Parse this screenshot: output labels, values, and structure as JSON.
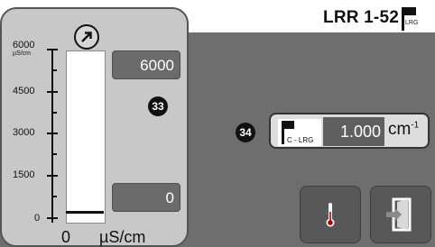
{
  "header": {
    "model": "LRR 1-52",
    "flag_text": "LRG"
  },
  "level_panel": {
    "scale": [
      "6000",
      "4500",
      "3000",
      "1500",
      "0"
    ],
    "scale_unit": "µS/cm",
    "max_value": "6000",
    "min_value": "0",
    "bottom_value": "0",
    "bottom_unit": "µS/cm",
    "badge": "33",
    "fill_fraction": 0.0
  },
  "cell_constant": {
    "badge": "34",
    "flag_text": "C - LRG",
    "value": "1.000",
    "unit": "cm",
    "unit_exp": "-1"
  },
  "icons": {
    "up_button": "arrow-up-right-circle-icon",
    "thermometer": "thermometer-icon",
    "exit": "exit-door-icon"
  },
  "colors": {
    "panel": "#c8c8c8",
    "background": "#6e6e6e",
    "value_box": "#6b6b6b"
  }
}
